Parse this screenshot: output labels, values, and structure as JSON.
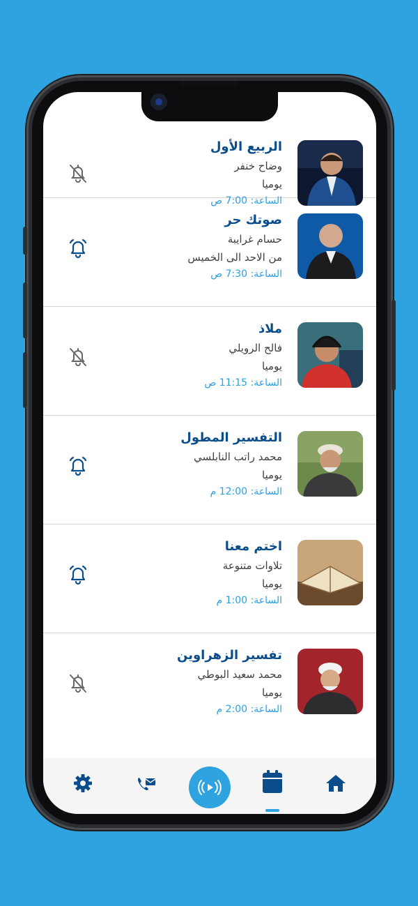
{
  "programs": [
    {
      "title": "الربيع الأول",
      "host": "وضاح خنفر",
      "days": "يوميا",
      "time": "الساعة: 7:00 ص",
      "reminder": "off"
    },
    {
      "title": "صوتك حر",
      "host": "حسام غرايبة",
      "days": "من الاحد الى الخميس",
      "time": "الساعة: 7:30 ص",
      "reminder": "on"
    },
    {
      "title": "ملاذ",
      "host": "فالح الرويلي",
      "days": "يوميا",
      "time": "الساعة: 11:15 ص",
      "reminder": "off"
    },
    {
      "title": "التفسير المطول",
      "host": "محمد راتب النابلسي",
      "days": "يوميا",
      "time": "الساعة: 12:00 م",
      "reminder": "on"
    },
    {
      "title": "اختم معنا",
      "host": "تلاوات متنوعة",
      "days": "يوميا",
      "time": "الساعة: 1:00 م",
      "reminder": "on"
    },
    {
      "title": "تفسير الزهراوين",
      "host": "محمد سعيد البوطي",
      "days": "يوميا",
      "time": "الساعة: 2:00 م",
      "reminder": "off"
    }
  ],
  "bottom_nav": [
    {
      "icon": "settings-icon"
    },
    {
      "icon": "phone-mail-icon"
    },
    {
      "icon": "live-radio-icon"
    },
    {
      "icon": "calendar-icon",
      "active": true
    },
    {
      "icon": "home-icon"
    }
  ],
  "colors": {
    "accent": "#2ea3df",
    "title": "#0b4d8a",
    "nav_icon": "#0b4d8a"
  }
}
